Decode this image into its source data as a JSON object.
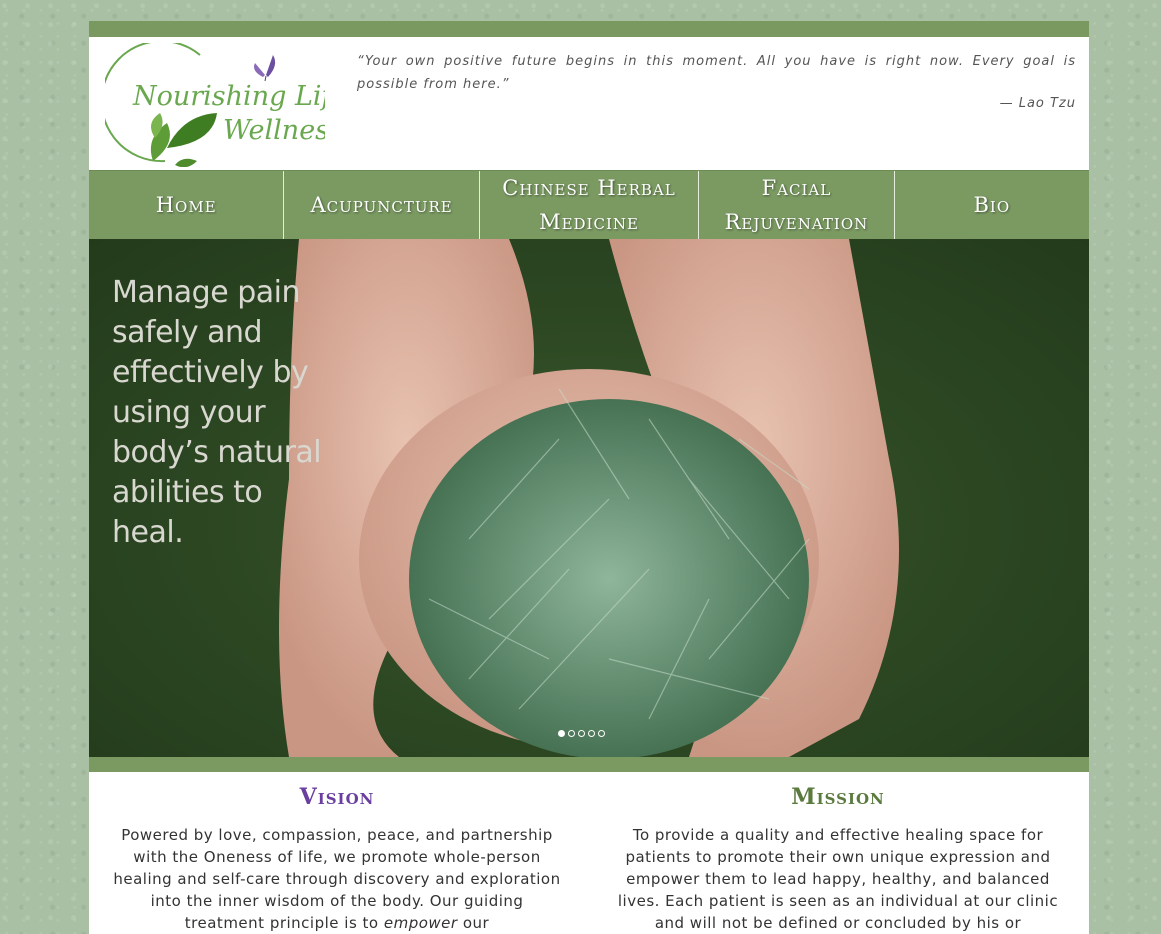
{
  "header": {
    "logo": {
      "line1": "Nourishing Life",
      "line2": "Wellness",
      "brand_green": "#6aa84f",
      "accent_purple": "#7b5ea7"
    },
    "quote": "“Your own positive future begins in this moment. All you have is right now. Every goal is possible from here.”",
    "quote_author": "— Lao Tzu"
  },
  "nav": {
    "items": [
      {
        "label": "Home"
      },
      {
        "label": "Acupuncture"
      },
      {
        "label": "Chinese Herbal Medicine"
      },
      {
        "label": "Facial Rejuvenation"
      },
      {
        "label": "Bio"
      }
    ]
  },
  "hero": {
    "text": "Manage pain safely and effectively by using your body’s natural abilities to heal.",
    "slide_count": 5,
    "active_slide": 1
  },
  "vision": {
    "title": "Vision",
    "color": "#6b3fa0",
    "text_before": "Powered by love, compassion, peace, and partnership with the Oneness of life, we promote whole-person healing and self-care through discovery and exploration into the inner wisdom of the body. Our guiding treatment principle is to ",
    "text_em": "empower",
    "text_after": " our"
  },
  "mission": {
    "title": "Mission",
    "color": "#5b7a3e",
    "text": "To provide a quality and effective healing space for patients to promote their own unique expression and empower them to lead happy, healthy, and balanced lives. Each patient is seen as an individual at our clinic and will not be defined or concluded by his or"
  },
  "colors": {
    "bar_green": "#7b9a62",
    "page_bg": "#a9c0a4"
  }
}
